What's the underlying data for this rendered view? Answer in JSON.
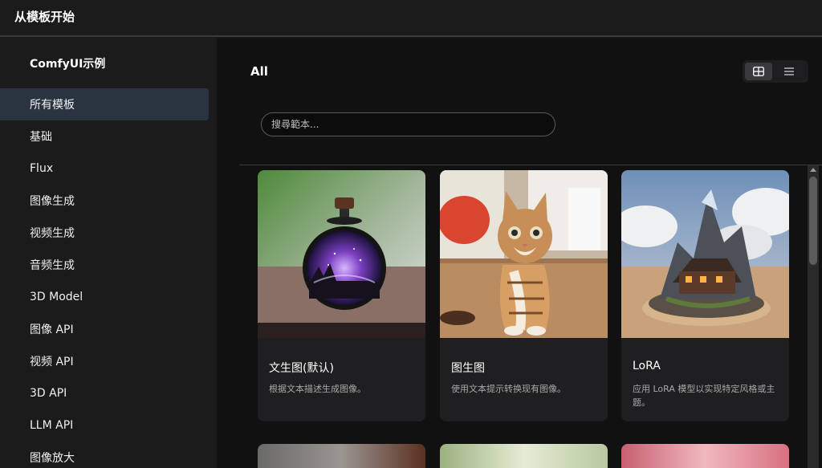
{
  "window": {
    "title": "从模板开始"
  },
  "sidebar": {
    "brand": "ComfyUI示例",
    "items": [
      {
        "label": "所有模板",
        "active": true
      },
      {
        "label": "基础"
      },
      {
        "label": "Flux"
      },
      {
        "label": "图像生成"
      },
      {
        "label": "视频生成"
      },
      {
        "label": "音频生成"
      },
      {
        "label": "3D Model"
      },
      {
        "label": "图像 API"
      },
      {
        "label": "视频 API"
      },
      {
        "label": "3D API"
      },
      {
        "label": "LLM API"
      },
      {
        "label": "图像放大"
      }
    ]
  },
  "main": {
    "heading": "All",
    "view_toggle": {
      "selected": "grid",
      "options": [
        "grid-icon",
        "list-icon"
      ]
    },
    "search": {
      "placeholder": "搜尋範本..."
    },
    "cards": [
      {
        "title": "文生图(默认)",
        "desc": "根据文本描述生成图像。",
        "thumb_icon": "starry-bottle-image"
      },
      {
        "title": "图生图",
        "desc": "使用文本提示转换现有图像。",
        "thumb_icon": "cat-image"
      },
      {
        "title": "LoRA",
        "desc": "应用 LoRA 模型以实现特定风格或主题。",
        "thumb_icon": "fantasy-house-image"
      }
    ]
  },
  "colors": {
    "active_nav": "#2a3441",
    "card_bg": "#1f1f21",
    "main_bg": "#111112"
  }
}
